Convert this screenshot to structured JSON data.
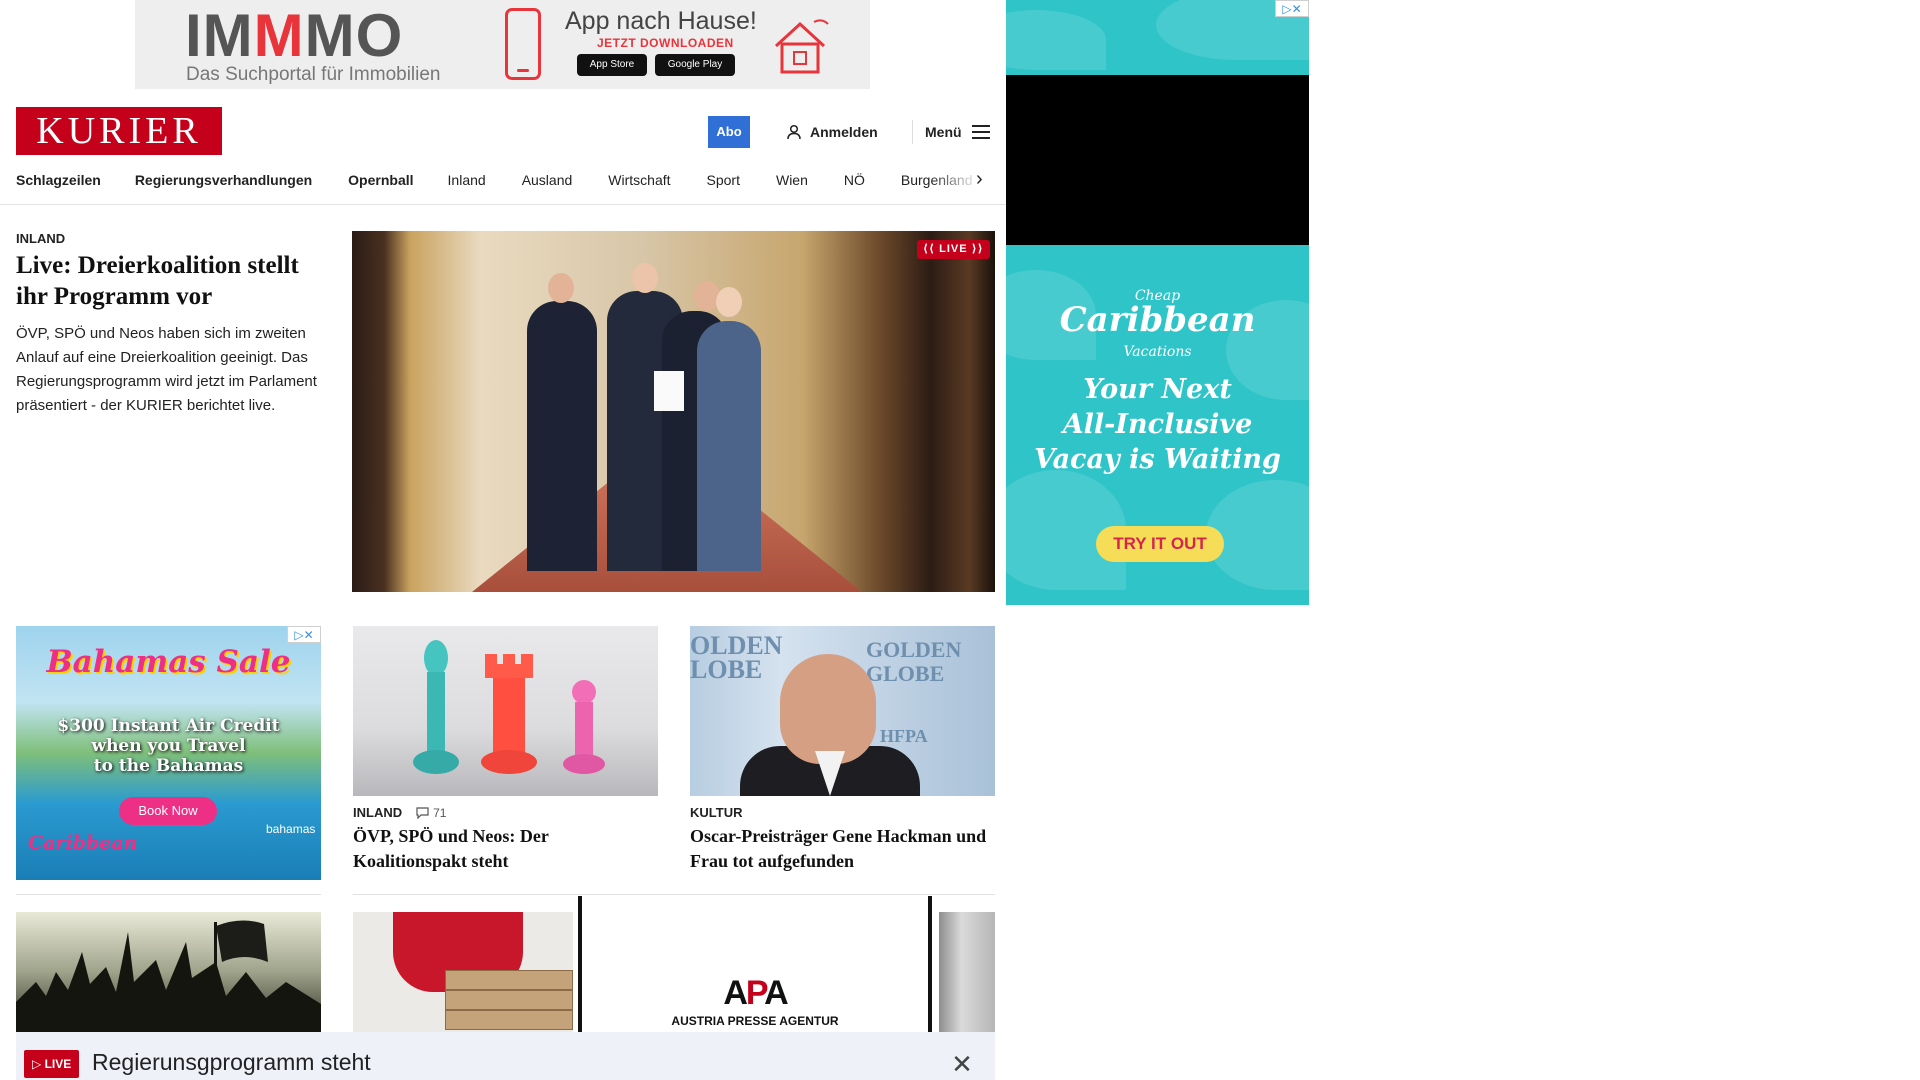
{
  "top_ad": {
    "brand_prefix": "IM",
    "brand_mid": "M",
    "brand_suffix": "MO",
    "tagline": "Das Suchportal für Immobilien",
    "headline": "App nach Hause!",
    "cta": "JETZT DOWNLOADEN",
    "store_apple": "App Store",
    "store_google": "Google Play"
  },
  "header": {
    "logo": "KURIER",
    "abo": "Abo",
    "login": "Anmelden",
    "menu": "Menü"
  },
  "nav": {
    "items": [
      "Schlagzeilen",
      "Regierungsverhandlungen",
      "Opernball",
      "Inland",
      "Ausland",
      "Wirtschaft",
      "Sport",
      "Wien",
      "NÖ",
      "Burgenland"
    ]
  },
  "lead": {
    "kicker": "INLAND",
    "title": "Live: Dreierkoalition stellt ihr Programm vor",
    "text": "ÖVP, SPÖ und Neos haben sich im zweiten Anlauf auf eine Dreierkoalition geeinigt. Das Regierungsprogramm wird jetzt im Parlament präsentiert - der KURIER berichtet live.",
    "badge": "LIVE"
  },
  "ad_bahamas": {
    "title": "Bahamas Sale",
    "text_line1": "$300 Instant Air Credit",
    "text_line2": "when you Travel",
    "text_line3": "to the Bahamas",
    "button": "Book Now",
    "logo": "Caribbean",
    "logo2": "bahamas"
  },
  "cards": [
    {
      "kicker": "INLAND",
      "comments": "71",
      "title": "ÖVP, SPÖ und Neos: Der Koalitionspakt steht"
    },
    {
      "kicker": "KULTUR",
      "title": "Oscar-Preisträger Gene Hackman und Frau tot aufgefunden"
    }
  ],
  "hackman_img": {
    "text_left": "OLDEN LOBE",
    "text_top": "GOLDEN GLOBE",
    "text_sub": "HFPA"
  },
  "sky_ad": {
    "logo_top": "Cheap",
    "logo_main": "Caribbean",
    "logo_bottom": "Vacations",
    "headline_line1": "Your Next",
    "headline_line2": "All-Inclusive",
    "headline_line3": "Vacay is Waiting",
    "cta": "TRY IT OUT"
  },
  "apa": {
    "logo_a1": "A",
    "logo_p": "P",
    "logo_a2": "A",
    "subtitle": "AUSTRIA PRESSE AGENTUR"
  },
  "ticker": {
    "badge": "LIVE",
    "text": "Regierunsgprogramm steht",
    "close": "✕"
  },
  "colors": {
    "brand_red": "#c4001a",
    "abo_blue": "#2f6fd6",
    "ticker_bg": "#eef1f8"
  }
}
